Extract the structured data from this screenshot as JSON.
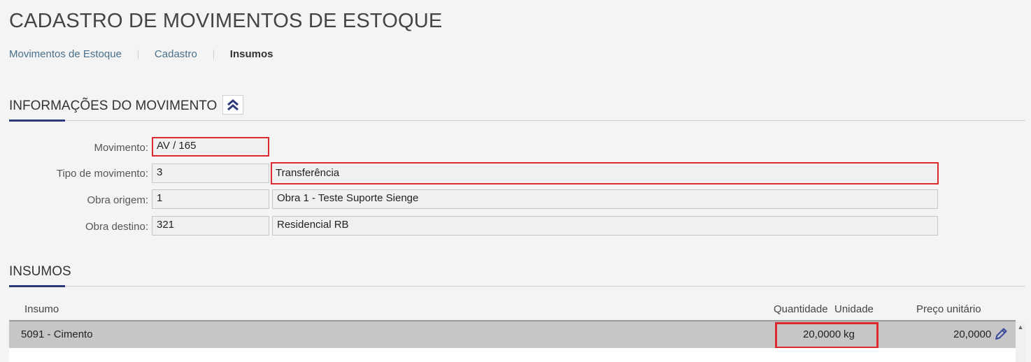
{
  "page": {
    "title": "CADASTRO DE MOVIMENTOS DE ESTOQUE"
  },
  "breadcrumb": [
    {
      "label": "Movimentos de Estoque"
    },
    {
      "label": "Cadastro"
    },
    {
      "label": "Insumos"
    }
  ],
  "info_section": {
    "title": "INFORMAÇÕES DO MOVIMENTO",
    "toggle_icon": "double-chevron-up-icon",
    "fields": {
      "movimento": {
        "label": "Movimento:",
        "value": "AV / 165"
      },
      "tipo": {
        "label": "Tipo de movimento:",
        "code": "3",
        "description": "Transferência"
      },
      "origem": {
        "label": "Obra origem:",
        "code": "1",
        "description": "Obra 1 - Teste Suporte Sienge"
      },
      "destino": {
        "label": "Obra destino:",
        "code": "321",
        "description": "Residencial RB"
      }
    }
  },
  "insumos_section": {
    "title": "INSUMOS",
    "columns": {
      "insumo": "Insumo",
      "quantidade": "Quantidade",
      "unidade": "Unidade",
      "preco": "Preço unitário"
    },
    "rows": [
      {
        "insumo": "5091 - Cimento",
        "quantidade": "20,0000",
        "unidade": "kg",
        "preco": "20,0000",
        "action_icon": "pencil-icon"
      }
    ]
  },
  "colors": {
    "accent": "#2d3a7c",
    "highlight": "#dc2a30",
    "selected_row": "#c6c6c6"
  }
}
